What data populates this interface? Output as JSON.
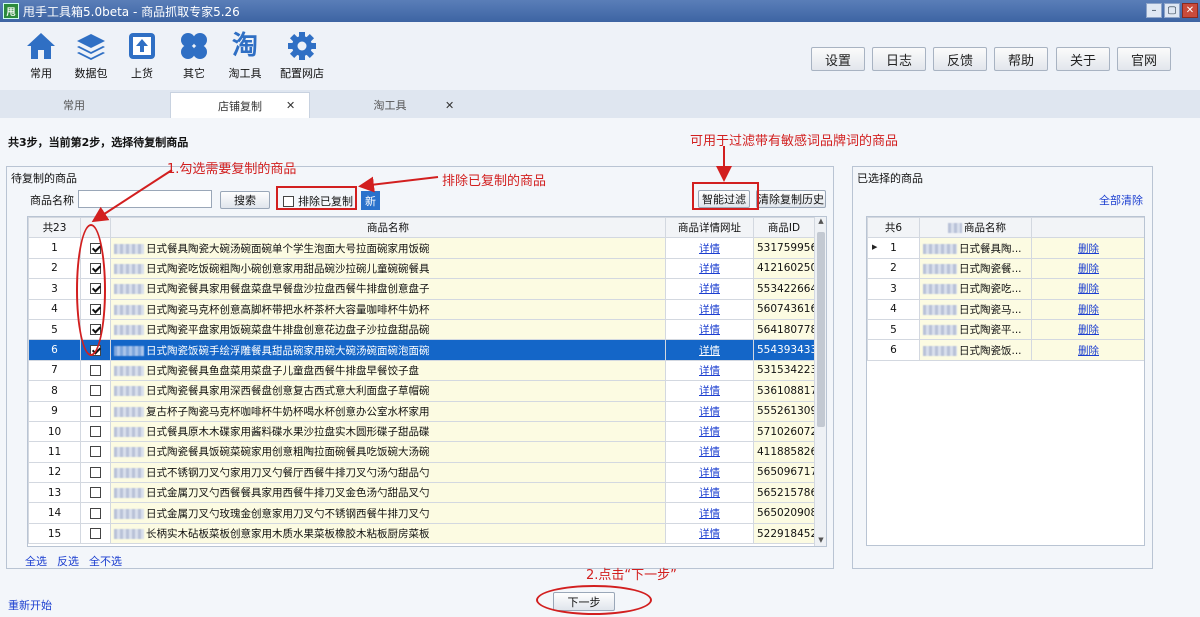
{
  "window": {
    "title": "甩手工具箱5.0beta - 商品抓取专家5.26",
    "app_icon_text": "甩"
  },
  "toolbar": {
    "items": [
      {
        "label": "常用",
        "icon": "home-icon"
      },
      {
        "label": "数据包",
        "icon": "layers-icon"
      },
      {
        "label": "上货",
        "icon": "upload-icon"
      },
      {
        "label": "其它",
        "icon": "clover-icon"
      },
      {
        "label": "淘工具",
        "icon": "tao-icon"
      },
      {
        "label": "配置网店",
        "icon": "gear-icon"
      }
    ],
    "buttons": [
      "设置",
      "日志",
      "反馈",
      "帮助",
      "关于",
      "官网"
    ]
  },
  "tabs": [
    {
      "label": "常用"
    },
    {
      "label": "店铺复制"
    },
    {
      "label": "淘工具"
    }
  ],
  "step_title": "共3步，当前第2步，选择待复制商品",
  "left_panel": {
    "title": "待复制的商品",
    "search_label": "商品名称",
    "search_value": "",
    "search_button": "搜索",
    "exclude_label": "排除已复制",
    "new_badge": "新",
    "filter_button": "智能过滤",
    "clear_history_button": "清除复制历史",
    "columns": [
      "共23",
      "商品名称",
      "商品详情网址",
      "商品ID"
    ],
    "link_text": "详情",
    "rows": [
      {
        "n": "1",
        "checked": true,
        "name": "日式餐具陶瓷大碗汤碗面碗单个学生泡面大号拉面碗家用饭碗",
        "id": "531759956696"
      },
      {
        "n": "2",
        "checked": true,
        "name": "日式陶瓷吃饭碗粗陶小碗创意家用甜品碗沙拉碗儿童碗碗餐具",
        "id": "41216025019"
      },
      {
        "n": "3",
        "checked": true,
        "name": "日式陶瓷餐具家用餐盘菜盘早餐盘沙拉盘西餐牛排盘创意盘子",
        "id": "553422664329"
      },
      {
        "n": "4",
        "checked": true,
        "name": "日式陶瓷马克杯创意高脚杯带把水杯茶杯大容量咖啡杯牛奶杯",
        "id": "560743616748"
      },
      {
        "n": "5",
        "checked": true,
        "name": "日式陶瓷平盘家用饭碗菜盘牛排盘创意花边盘子沙拉盘甜品碗",
        "id": "564180778763"
      },
      {
        "n": "6",
        "checked": true,
        "name": "日式陶瓷饭碗手绘浮雕餐具甜品碗家用碗大碗汤碗面碗泡面碗",
        "id": "554393433638"
      },
      {
        "n": "7",
        "checked": false,
        "name": "日式陶瓷餐具鱼盘菜用菜盘子儿童盘西餐牛排盘早餐饺子盘",
        "id": "531534223157"
      },
      {
        "n": "8",
        "checked": false,
        "name": "日式陶瓷餐具家用深西餐盘创意复古西式意大利面盘子草帽碗",
        "id": "536108817468"
      },
      {
        "n": "9",
        "checked": false,
        "name": "复古杯子陶瓷马克杯咖啡杯牛奶杯喝水杯创意办公室水杯家用",
        "id": "555261309596"
      },
      {
        "n": "10",
        "checked": false,
        "name": "日式餐具原木木碟家用酱料碟水果沙拉盘实木圆形碟子甜品碟",
        "id": "571026072239"
      },
      {
        "n": "11",
        "checked": false,
        "name": "日式陶瓷餐具饭碗菜碗家用创意粗陶拉面碗餐具吃饭碗大汤碗",
        "id": "41188582660"
      },
      {
        "n": "12",
        "checked": false,
        "name": "日式不锈钢刀叉勺家用刀叉勺餐厅西餐牛排刀叉勺汤勺甜品勺",
        "id": "565096717727"
      },
      {
        "n": "13",
        "checked": false,
        "name": "日式金属刀叉勺西餐餐具家用西餐牛排刀叉金色汤勺甜品叉勺",
        "id": "565215786682"
      },
      {
        "n": "14",
        "checked": false,
        "name": "日式金属刀叉勺玫瑰金创意家用刀叉勺不锈钢西餐牛排刀叉勺",
        "id": "565020908473"
      },
      {
        "n": "15",
        "checked": false,
        "name": "长柄实木砧板菜板创意家用木质水果菜板橡胶木粘板厨房菜板",
        "id": "522918452980"
      }
    ],
    "select_all": "全选",
    "invert": "反选",
    "select_none": "全不选"
  },
  "right_panel": {
    "title": "已选择的商品",
    "clear_all": "全部清除",
    "columns": [
      "共6",
      "商品名称",
      ""
    ],
    "delete_text": "删除",
    "rows": [
      {
        "n": "1",
        "name": "日式餐具陶..."
      },
      {
        "n": "2",
        "name": "日式陶瓷餐..."
      },
      {
        "n": "3",
        "name": "日式陶瓷吃..."
      },
      {
        "n": "4",
        "name": "日式陶瓷马..."
      },
      {
        "n": "5",
        "name": "日式陶瓷平..."
      },
      {
        "n": "6",
        "name": "日式陶瓷饭..."
      }
    ]
  },
  "footer": {
    "restart": "重新开始",
    "next_button": "下一步"
  },
  "annotations": {
    "a1": "1.勾选需要复制的商品",
    "a2": "排除已复制的商品",
    "a3": "可用于过滤带有敏感词品牌词的商品",
    "a4": "2.点击“下一步”"
  },
  "colors": {
    "annotation_red": "#d21f1f",
    "selection_blue": "#1466c8",
    "link_blue": "#1c3fd0"
  }
}
